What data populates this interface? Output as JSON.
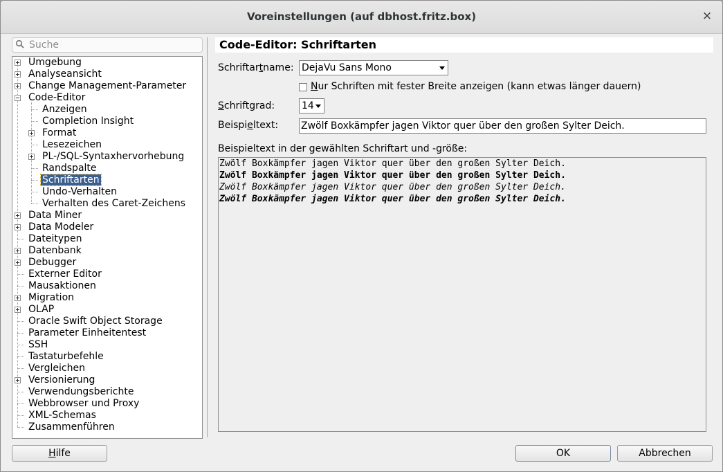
{
  "window": {
    "title": "Voreinstellungen (auf dbhost.fritz.box)",
    "close_glyph": "×"
  },
  "search": {
    "placeholder": "Suche"
  },
  "tree": {
    "items": [
      {
        "label": "Umgebung",
        "expander": "plus"
      },
      {
        "label": "Analyseansicht",
        "expander": "plus"
      },
      {
        "label": "Change Management-Parameter",
        "expander": "plus"
      },
      {
        "label": "Code-Editor",
        "expander": "minus"
      },
      {
        "label": "Anzeigen"
      },
      {
        "label": "Completion Insight"
      },
      {
        "label": "Format",
        "expander": "plus"
      },
      {
        "label": "Lesezeichen"
      },
      {
        "label": "PL-/SQL-Syntaxhervorhebung",
        "expander": "plus"
      },
      {
        "label": "Randspalte"
      },
      {
        "label": "Schriftarten",
        "selected": true
      },
      {
        "label": "Undo-Verhalten"
      },
      {
        "label": "Verhalten des Caret-Zeichens"
      },
      {
        "label": "Data Miner",
        "expander": "plus"
      },
      {
        "label": "Data Modeler",
        "expander": "plus"
      },
      {
        "label": "Dateitypen"
      },
      {
        "label": "Datenbank",
        "expander": "plus"
      },
      {
        "label": "Debugger",
        "expander": "plus"
      },
      {
        "label": "Externer Editor"
      },
      {
        "label": "Mausaktionen"
      },
      {
        "label": "Migration",
        "expander": "plus"
      },
      {
        "label": "OLAP",
        "expander": "plus"
      },
      {
        "label": "Oracle Swift Object Storage"
      },
      {
        "label": "Parameter Einheitentest"
      },
      {
        "label": "SSH"
      },
      {
        "label": "Tastaturbefehle"
      },
      {
        "label": "Vergleichen"
      },
      {
        "label": "Versionierung",
        "expander": "plus"
      },
      {
        "label": "Verwendungsberichte"
      },
      {
        "label": "Webbrowser und Proxy"
      },
      {
        "label": "XML-Schemas"
      },
      {
        "label": "Zusammenführen"
      }
    ]
  },
  "panel": {
    "title": "Code-Editor: Schriftarten",
    "fontname_label": {
      "before": "Schriftar",
      "mnemonic": "t",
      "after": "name:"
    },
    "fontname_value": "DejaVu Sans Mono",
    "monospace_checkbox": {
      "mnemonic": "N",
      "after": "ur Schriften mit fester Breite anzeigen (kann etwas länger dauern)",
      "checked": false
    },
    "fontsize_label": {
      "mnemonic": "S",
      "after": "chriftgrad:"
    },
    "fontsize_value": "14",
    "sample_label": {
      "before": "Beispi",
      "mnemonic": "e",
      "after": "ltext:"
    },
    "sample_value": "Zwölf Boxkämpfer jagen Viktor quer über den großen Sylter Deich.",
    "preview_label": "Beispieltext in der gewählten Schriftart und -größe:",
    "preview_lines": [
      "Zwölf Boxkämpfer jagen Viktor quer über den großen Sylter Deich.",
      "Zwölf Boxkämpfer jagen Viktor quer über den großen Sylter Deich.",
      "Zwölf Boxkämpfer jagen Viktor quer über den großen Sylter Deich.",
      "Zwölf Boxkämpfer jagen Viktor quer über den großen Sylter Deich."
    ]
  },
  "buttons": {
    "help": {
      "mnemonic": "H",
      "after": "ilfe"
    },
    "ok": "OK",
    "cancel": "Abbrechen"
  },
  "colors": {
    "selection": "#3b5f8f",
    "dialog_bg": "#efefef"
  }
}
